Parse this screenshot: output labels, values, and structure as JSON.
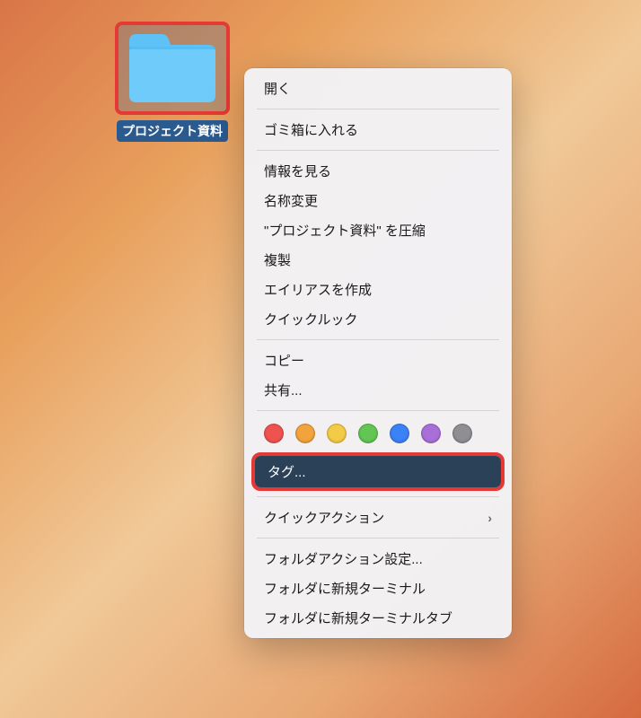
{
  "folder": {
    "name": "プロジェクト資料"
  },
  "menu": {
    "open": "開く",
    "trash": "ゴミ箱に入れる",
    "get_info": "情報を見る",
    "rename": "名称変更",
    "compress": "\"プロジェクト資料\" を圧縮",
    "duplicate": "複製",
    "make_alias": "エイリアスを作成",
    "quick_look": "クイックルック",
    "copy": "コピー",
    "share": "共有...",
    "tags": "タグ...",
    "quick_actions": "クイックアクション",
    "folder_actions_setup": "フォルダアクション設定...",
    "new_terminal_at_folder": "フォルダに新規ターミナル",
    "new_terminal_tab_at_folder": "フォルダに新規ターミナルタブ"
  },
  "tag_colors": {
    "red": "#ef5350",
    "orange": "#f2a33c",
    "yellow": "#f3cb46",
    "green": "#62c554",
    "blue": "#3b82f6",
    "purple": "#a96fd8",
    "gray": "#8e8e93"
  }
}
